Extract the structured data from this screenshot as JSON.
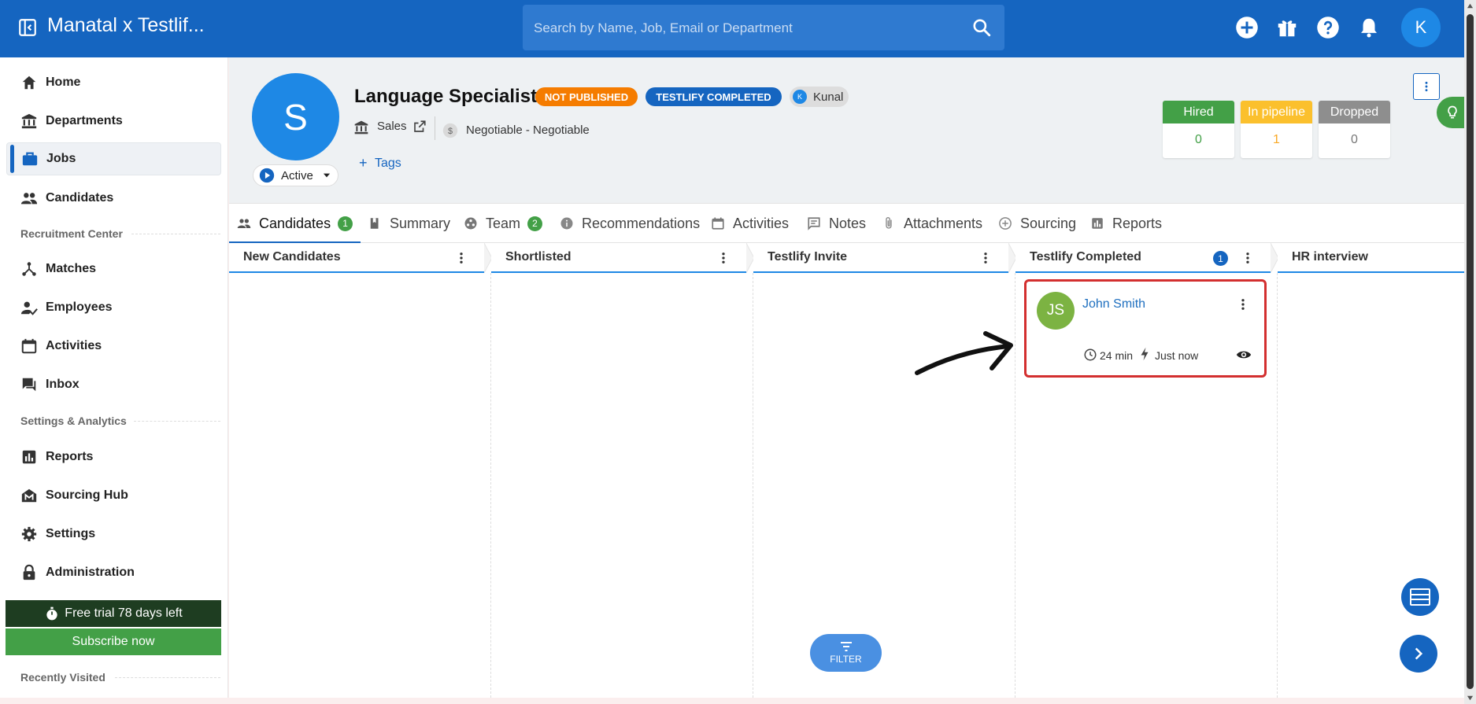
{
  "app": {
    "title": "Manatal x Testlif...",
    "user_initial": "K"
  },
  "search": {
    "placeholder": "Search by Name, Job, Email or Department"
  },
  "sidebar": {
    "items": [
      {
        "label": "Home",
        "icon": "home-icon"
      },
      {
        "label": "Departments",
        "icon": "bank-icon"
      },
      {
        "label": "Jobs",
        "icon": "briefcase-icon",
        "active": true
      },
      {
        "label": "Candidates",
        "icon": "people-icon"
      }
    ],
    "section_recruitment": "Recruitment Center",
    "recruitment_items": [
      {
        "label": "Matches",
        "icon": "hub-icon"
      },
      {
        "label": "Employees",
        "icon": "person-check-icon"
      },
      {
        "label": "Activities",
        "icon": "calendar-icon"
      },
      {
        "label": "Inbox",
        "icon": "chat-icon"
      }
    ],
    "section_settings": "Settings & Analytics",
    "settings_items": [
      {
        "label": "Reports",
        "icon": "bar-chart-icon"
      },
      {
        "label": "Sourcing Hub",
        "icon": "sourcing-hub-icon"
      },
      {
        "label": "Settings",
        "icon": "gear-icon"
      },
      {
        "label": "Administration",
        "icon": "lock-icon"
      }
    ],
    "trial_text": "Free trial 78 days left",
    "subscribe_label": "Subscribe now",
    "recently_visited": "Recently Visited"
  },
  "job": {
    "avatar_letter": "S",
    "title": "Language Specialist",
    "badge_not_published": "NOT PUBLISHED",
    "badge_testlify": "TESTLIFY COMPLETED",
    "owner_initial": "K",
    "owner": "Kunal",
    "department": "Sales",
    "salary": "Negotiable - Negotiable",
    "status": "Active",
    "tags_label": "Tags",
    "stats": [
      {
        "label": "Hired",
        "value": "0",
        "color": "#43a047",
        "value_color": "#43a047"
      },
      {
        "label": "In pipeline",
        "value": "1",
        "color": "#fbc02d",
        "value_color": "#f9a825"
      },
      {
        "label": "Dropped",
        "value": "0",
        "color": "#8e8e8e",
        "value_color": "#777777"
      }
    ]
  },
  "tabs": [
    {
      "label": "Candidates",
      "count": "1",
      "icon": "people-icon"
    },
    {
      "label": "Summary",
      "icon": "book-icon"
    },
    {
      "label": "Team",
      "count": "2",
      "icon": "team-icon"
    },
    {
      "label": "Recommendations",
      "icon": "info-icon"
    },
    {
      "label": "Activities",
      "icon": "calendar-icon"
    },
    {
      "label": "Notes",
      "icon": "note-icon"
    },
    {
      "label": "Attachments",
      "icon": "paperclip-icon"
    },
    {
      "label": "Sourcing",
      "icon": "add-circle-icon"
    },
    {
      "label": "Reports",
      "icon": "bar-chart-icon"
    }
  ],
  "pipeline": {
    "columns": [
      {
        "name": "New Candidates"
      },
      {
        "name": "Shortlisted"
      },
      {
        "name": "Testlify Invite"
      },
      {
        "name": "Testlify Completed",
        "count": "1"
      },
      {
        "name": "HR interview"
      }
    ],
    "card": {
      "initials": "JS",
      "name": "John Smith",
      "duration": "24 min",
      "time": "Just now"
    }
  },
  "filter_label": "FILTER",
  "colors": {
    "primary": "#1565c0",
    "highlight": "#d32f2f",
    "success": "#43a047"
  }
}
